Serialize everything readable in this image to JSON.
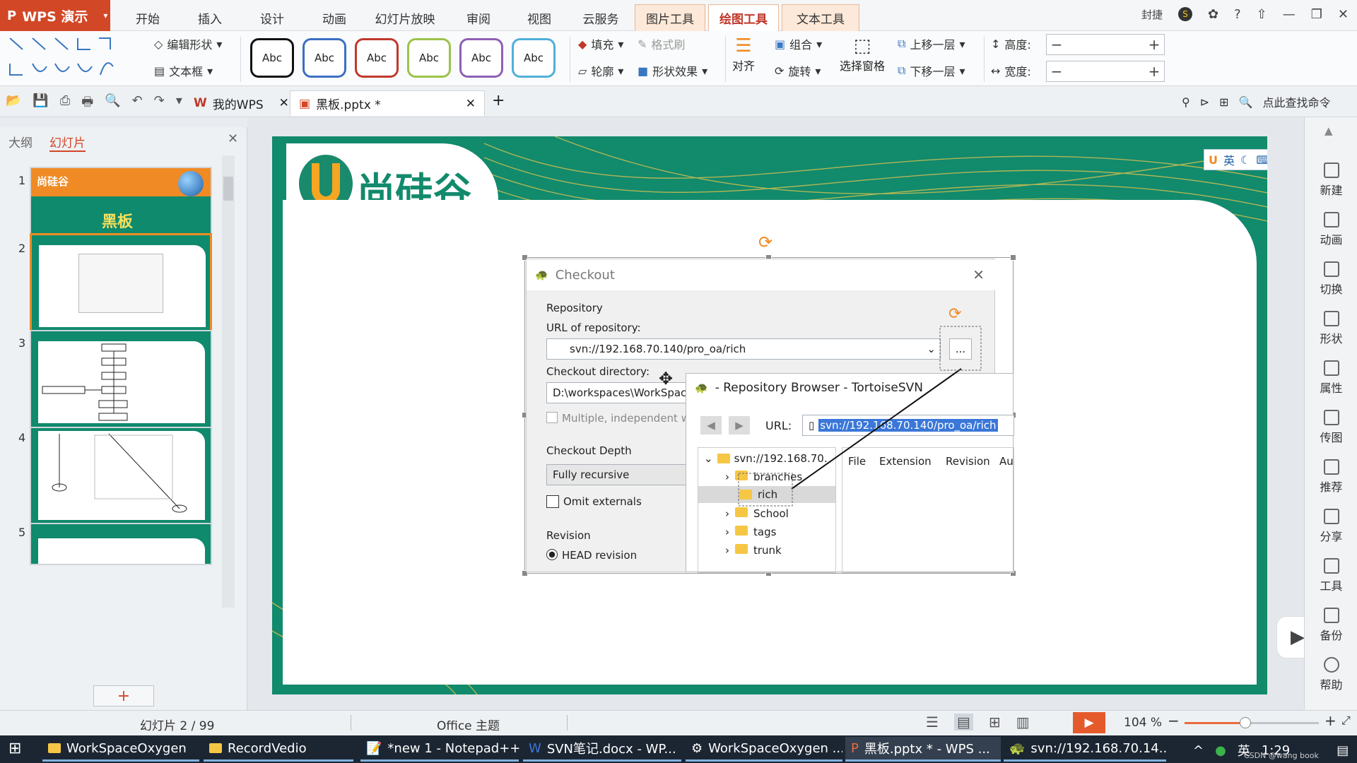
{
  "app": {
    "name": "WPS 演示"
  },
  "ribbon_tabs": [
    "开始",
    "插入",
    "设计",
    "动画",
    "幻灯片放映",
    "审阅",
    "视图",
    "云服务"
  ],
  "context_tabs": [
    "图片工具",
    "绘图工具",
    "文本工具"
  ],
  "active_tab": "绘图工具",
  "ribbon": {
    "edit_shape": "编辑形状",
    "text_box": "文本框",
    "style_sample": "Abc",
    "fill": "填充",
    "format_brush": "格式刷",
    "outline": "轮廓",
    "shape_effect": "形状效果",
    "align": "对齐",
    "group": "组合",
    "rotate": "旋转",
    "selection_pane": "选择窗格",
    "bring_forward": "上移一层",
    "send_backward": "下移一层",
    "height_label": "高度:",
    "width_label": "宽度:"
  },
  "topbar": {
    "user_label": "封捷",
    "badge": "S"
  },
  "qa": {
    "find_command": "点此查找命令"
  },
  "doc_tabs": [
    {
      "label": "我的WPS"
    },
    {
      "label": "黑板.pptx *"
    }
  ],
  "left_pane": {
    "tab_outline": "大纲",
    "tab_slides": "幻灯片",
    "thumb_numbers": [
      "1",
      "2",
      "3",
      "4",
      "5"
    ],
    "thumb1_title": "黑板",
    "thumb1_logo": "尚硅谷",
    "add_button": "+"
  },
  "slide": {
    "logo_text": "尚硅谷",
    "ime_bar": "英"
  },
  "checkout_dialog": {
    "title": "Checkout",
    "group_repository": "Repository",
    "url_label": "URL of repository:",
    "url_value": "svn://192.168.70.140/pro_oa/rich",
    "browse_button": "...",
    "dir_label": "Checkout directory:",
    "dir_value": "D:\\workspaces\\WorkSpace",
    "multiple_label": "Multiple, independent wo",
    "depth_group": "Checkout Depth",
    "depth_value": "Fully recursive",
    "omit_label": "Omit externals",
    "revision_group": "Revision",
    "head_label": "HEAD revision"
  },
  "repo_browser": {
    "title": "- Repository Browser - TortoiseSVN",
    "url_label": "URL:",
    "url_value": "svn://192.168.70.140/pro_oa/rich",
    "root": "svn://192.168.70.",
    "tree": [
      "branches",
      "rich",
      "School",
      "tags",
      "trunk"
    ],
    "columns": [
      "File",
      "Extension",
      "Revision",
      "Au"
    ]
  },
  "right_rail": [
    "新建",
    "动画",
    "切换",
    "形状",
    "属性",
    "传图",
    "推荐",
    "分享",
    "工具",
    "备份",
    "帮助"
  ],
  "status": {
    "slide_info": "幻灯片 2 / 99",
    "theme": "Office 主题",
    "zoom": "104 %",
    "zoom_level": 0.45
  },
  "taskbar": {
    "items": [
      "WorkSpaceOxygen",
      "RecordVedio",
      "*new 1 - Notepad++",
      "SVN笔记.docx - WP...",
      "WorkSpaceOxygen ...",
      "黑板.pptx * - WPS ...",
      "svn://192.168.70.14..."
    ],
    "ime": "英",
    "time": "1:29",
    "watermark": "CSDN @wang book"
  },
  "colors": {
    "brand": "#d24726",
    "slide_teal": "#128a6c",
    "accent_orange": "#f08a24",
    "logo_orange": "#f5a623"
  }
}
